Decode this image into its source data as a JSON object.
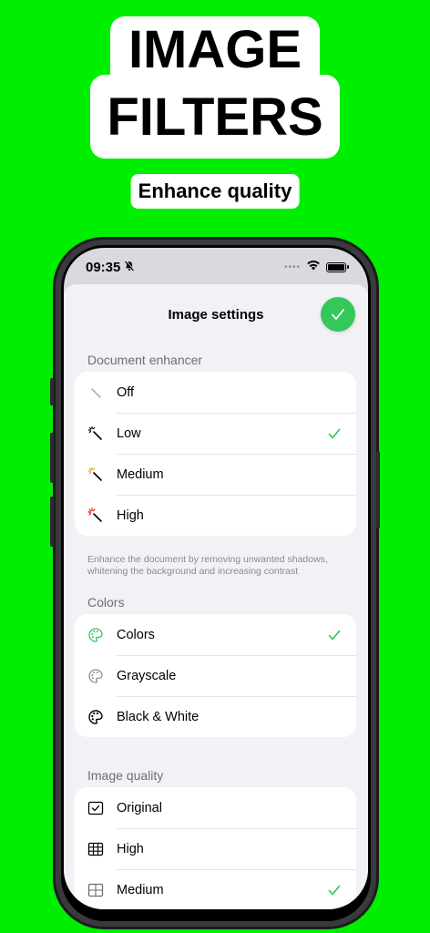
{
  "promo": {
    "headline_line1": "IMAGE",
    "headline_line2": "FILTERS",
    "subtitle": "Enhance quality"
  },
  "status_bar": {
    "time": "09:35",
    "icons": [
      "bell-slash-icon",
      "signal-dots-icon",
      "wifi-icon",
      "battery-icon"
    ]
  },
  "sheet": {
    "title": "Image settings",
    "done_icon": "checkmark-icon"
  },
  "document_enhancer": {
    "header": "Document enhancer",
    "options": [
      {
        "label": "Off",
        "icon": "magic-wand-off-icon",
        "selected": false
      },
      {
        "label": "Low",
        "icon": "magic-wand-low-icon",
        "selected": true
      },
      {
        "label": "Medium",
        "icon": "magic-wand-medium-icon",
        "selected": false
      },
      {
        "label": "High",
        "icon": "magic-wand-high-icon",
        "selected": false
      }
    ],
    "footnote": "Enhance the document by removing unwanted shadows, whitening the background and increasing contrast"
  },
  "colors": {
    "header": "Colors",
    "options": [
      {
        "label": "Colors",
        "icon": "palette-color-icon",
        "selected": true
      },
      {
        "label": "Grayscale",
        "icon": "palette-gray-icon",
        "selected": false
      },
      {
        "label": "Black & White",
        "icon": "palette-bw-icon",
        "selected": false
      }
    ]
  },
  "image_quality": {
    "header": "Image quality",
    "options": [
      {
        "label": "Original",
        "icon": "checkbox-square-icon",
        "selected": false
      },
      {
        "label": "High",
        "icon": "grid-fine-icon",
        "selected": false
      },
      {
        "label": "Medium",
        "icon": "grid-coarse-icon",
        "selected": true
      }
    ]
  },
  "colors_palette": {
    "background": "#00ee00",
    "accent_green": "#34c759",
    "enhancer_low": "#000000",
    "enhancer_medium": "#f0a020",
    "enhancer_high": "#e53935"
  }
}
